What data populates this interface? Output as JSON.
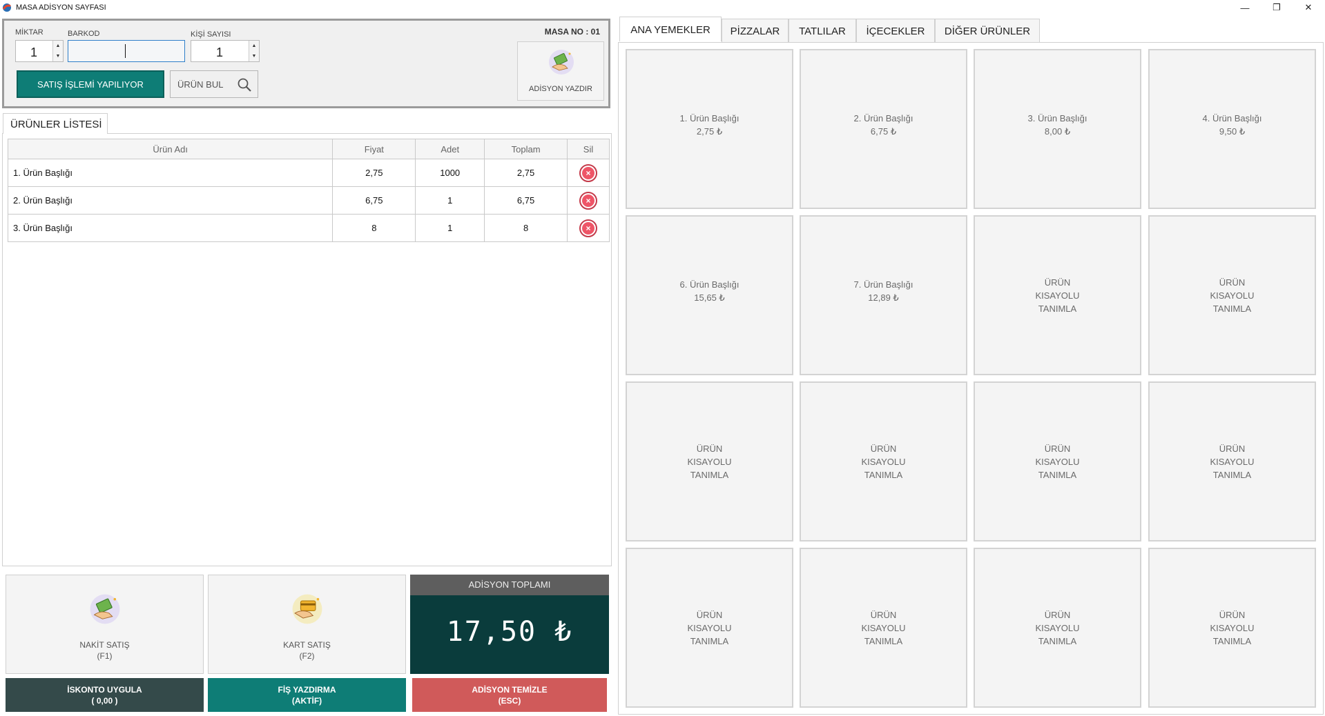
{
  "window": {
    "title": "MASA ADİSYON SAYFASI",
    "minimize": "—",
    "restore": "❐",
    "close": "✕"
  },
  "top_panel": {
    "miktar_label": "MİKTAR",
    "miktar_value": "1",
    "barkod_label": "BARKOD",
    "barkod_value": "",
    "kisi_label": "KİŞİ SAYISI",
    "kisi_value": "1",
    "satis_button": "SATIŞ İŞLEMİ YAPILIYOR",
    "urun_bul_button": "ÜRÜN BUL",
    "masa_no": "MASA NO : 01",
    "adisyon_yazdir_button": "ADİSYON YAZDIR"
  },
  "list": {
    "tab_label": "ÜRÜNLER LİSTESİ",
    "columns": [
      "Ürün Adı",
      "Fiyat",
      "Adet",
      "Toplam",
      "Sil"
    ],
    "rows": [
      {
        "name": "1. Ürün Başlığı",
        "price": "2,75",
        "qty": "1000",
        "total": "2,75"
      },
      {
        "name": "2. Ürün Başlığı",
        "price": "6,75",
        "qty": "1",
        "total": "6,75"
      },
      {
        "name": "3. Ürün Başlığı",
        "price": "8",
        "qty": "1",
        "total": "8"
      }
    ]
  },
  "bottom": {
    "nakit_line1": "NAKİT SATIŞ",
    "nakit_line2": "(F1)",
    "kart_line1": "KART SATIŞ",
    "kart_line2": "(F2)",
    "total_header": "ADİSYON TOPLAMI",
    "total_value": "17,50 ₺",
    "iskonto_line1": "İSKONTO UYGULA",
    "iskonto_line2": "( 0,00 )",
    "fis_line1": "FİŞ YAZDIRMA",
    "fis_line2": "(AKTİF)",
    "temizle_line1": "ADİSYON TEMİZLE",
    "temizle_line2": "(ESC)"
  },
  "categories": {
    "tabs": [
      "ANA YEMEKLER",
      "PİZZALAR",
      "TATLILAR",
      "İÇECEKLER",
      "DİĞER ÜRÜNLER"
    ],
    "active": 0
  },
  "shortcuts": [
    {
      "title": "1. Ürün Başlığı",
      "price": "2,75 ₺"
    },
    {
      "title": "2. Ürün Başlığı",
      "price": "6,75 ₺"
    },
    {
      "title": "3. Ürün Başlığı",
      "price": "8,00 ₺"
    },
    {
      "title": "4. Ürün Başlığı",
      "price": "9,50 ₺"
    },
    {
      "title": "6. Ürün Başlığı",
      "price": "15,65 ₺"
    },
    {
      "title": "7. Ürün Başlığı",
      "price": "12,89 ₺"
    },
    {
      "title": "ÜRÜN",
      "price": "KISAYOLU",
      "extra": "TANIMLA"
    },
    {
      "title": "ÜRÜN",
      "price": "KISAYOLU",
      "extra": "TANIMLA"
    },
    {
      "title": "ÜRÜN",
      "price": "KISAYOLU",
      "extra": "TANIMLA"
    },
    {
      "title": "ÜRÜN",
      "price": "KISAYOLU",
      "extra": "TANIMLA"
    },
    {
      "title": "ÜRÜN",
      "price": "KISAYOLU",
      "extra": "TANIMLA"
    },
    {
      "title": "ÜRÜN",
      "price": "KISAYOLU",
      "extra": "TANIMLA"
    },
    {
      "title": "ÜRÜN",
      "price": "KISAYOLU",
      "extra": "TANIMLA"
    },
    {
      "title": "ÜRÜN",
      "price": "KISAYOLU",
      "extra": "TANIMLA"
    },
    {
      "title": "ÜRÜN",
      "price": "KISAYOLU",
      "extra": "TANIMLA"
    },
    {
      "title": "ÜRÜN",
      "price": "KISAYOLU",
      "extra": "TANIMLA"
    }
  ],
  "colors": {
    "teal": "#0e7d76",
    "dark_teal": "#0a3c3c",
    "slate": "#344a4a",
    "red": "#d05a5a",
    "delete_red": "#ee5567"
  },
  "icons": {
    "app": "app-logo-icon",
    "search": "magnifier-icon",
    "cash": "cash-hand-icon",
    "card": "card-hand-icon",
    "delete": "delete-x-icon"
  }
}
